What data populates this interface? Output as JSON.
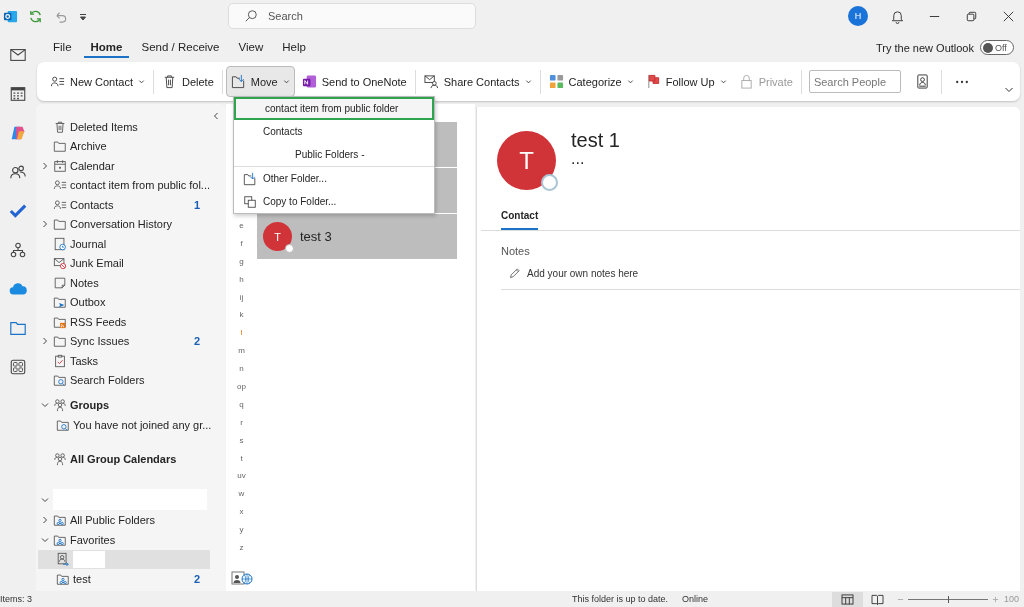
{
  "title_bar": {
    "search_placeholder": "Search",
    "avatar_initial": "H"
  },
  "menu_tabs": [
    {
      "label": "File",
      "selected": false
    },
    {
      "label": "Home",
      "selected": true
    },
    {
      "label": "Send / Receive",
      "selected": false
    },
    {
      "label": "View",
      "selected": false
    },
    {
      "label": "Help",
      "selected": false
    }
  ],
  "new_outlook": {
    "label": "Try the new Outlook",
    "toggle_text": "Off",
    "on": false
  },
  "ribbon": [
    {
      "kind": "button",
      "label": "New Contact",
      "dropdown": true,
      "pressed": false,
      "disabled": false
    },
    {
      "kind": "separator"
    },
    {
      "kind": "button",
      "label": "Delete",
      "pressed": false,
      "disabled": false
    },
    {
      "kind": "separator"
    },
    {
      "kind": "button",
      "label": "Move",
      "dropdown": true,
      "pressed": true,
      "disabled": false
    },
    {
      "kind": "button",
      "label": "Send to OneNote",
      "pressed": false,
      "disabled": false
    },
    {
      "kind": "separator"
    },
    {
      "kind": "button",
      "label": "Share Contacts",
      "dropdown": true,
      "pressed": false,
      "disabled": false
    },
    {
      "kind": "separator"
    },
    {
      "kind": "button",
      "label": "Categorize",
      "dropdown": true,
      "pressed": false,
      "disabled": false
    },
    {
      "kind": "button",
      "label": "Follow Up",
      "dropdown": true,
      "pressed": false,
      "disabled": false
    },
    {
      "kind": "button",
      "label": "Private",
      "pressed": false,
      "disabled": true
    },
    {
      "kind": "separator"
    },
    {
      "kind": "search",
      "placeholder": "Search People"
    },
    {
      "kind": "address_book"
    },
    {
      "kind": "separator"
    },
    {
      "kind": "more"
    }
  ],
  "folders": [
    {
      "label": "Deleted Items",
      "selected": false
    },
    {
      "label": "Archive",
      "selected": false
    },
    {
      "label": "Calendar",
      "expanded": false,
      "selected": false
    },
    {
      "label": "contact item from public fol...",
      "selected": false
    },
    {
      "label": "Contacts",
      "count": "1",
      "selected": false
    },
    {
      "label": "Conversation History",
      "expanded": false,
      "selected": false
    },
    {
      "label": "Journal",
      "selected": false
    },
    {
      "label": "Junk Email",
      "selected": false
    },
    {
      "label": "Notes",
      "selected": false
    },
    {
      "label": "Outbox",
      "selected": false
    },
    {
      "label": "RSS Feeds",
      "selected": false
    },
    {
      "label": "Sync Issues",
      "count": "2",
      "expanded": false,
      "selected": false
    },
    {
      "label": "Tasks",
      "selected": false
    },
    {
      "label": "Search Folders",
      "selected": false
    }
  ],
  "groups": {
    "label": "Groups",
    "expanded": true,
    "children": [
      {
        "label": "You have not joined any gr..."
      }
    ]
  },
  "group_calendars": {
    "label": "All Group Calendars"
  },
  "public_section": {
    "expanded": true,
    "items": [
      {
        "label": "All Public Folders",
        "expanded": false,
        "selected": false
      },
      {
        "label": "Favorites",
        "expanded": true,
        "selected": false,
        "children": [
          {
            "redacted": true,
            "selected": true
          },
          {
            "label": "test",
            "count": "2",
            "selected": false
          }
        ]
      }
    ]
  },
  "alphabet": [
    {
      "label": "e",
      "highlighted": false
    },
    {
      "label": "f",
      "highlighted": false
    },
    {
      "label": "g",
      "highlighted": false
    },
    {
      "label": "h",
      "highlighted": false
    },
    {
      "label": "ij",
      "highlighted": false
    },
    {
      "label": "k",
      "highlighted": false
    },
    {
      "label": "l",
      "highlighted": true
    },
    {
      "label": "m",
      "highlighted": false
    },
    {
      "label": "n",
      "highlighted": false
    },
    {
      "label": "op",
      "highlighted": false
    },
    {
      "label": "q",
      "highlighted": false
    },
    {
      "label": "r",
      "highlighted": false
    },
    {
      "label": "s",
      "highlighted": false
    },
    {
      "label": "t",
      "highlighted": false
    },
    {
      "label": "uv",
      "highlighted": false
    },
    {
      "label": "w",
      "highlighted": false
    },
    {
      "label": "x",
      "highlighted": false
    },
    {
      "label": "y",
      "highlighted": false
    },
    {
      "label": "z",
      "highlighted": false
    }
  ],
  "contacts": [
    {
      "kind": "covered",
      "selected": true
    },
    {
      "kind": "covered",
      "selected": true
    },
    {
      "kind": "contact",
      "name": "test 3",
      "initial": "T",
      "selected": true
    }
  ],
  "move_menu": [
    {
      "kind": "recent",
      "label": "contact item from public folder",
      "selected": true
    },
    {
      "kind": "recent",
      "label": "Contacts",
      "selected": false
    },
    {
      "kind": "sub",
      "label": "Public Folders -",
      "selected": false
    },
    {
      "kind": "action",
      "label": "Other Folder...",
      "selected": false
    },
    {
      "kind": "action",
      "label": "Copy to Folder...",
      "selected": false
    }
  ],
  "contact_card": {
    "initial": "T",
    "name": "test 1",
    "subtitle": "...",
    "tabs": [
      {
        "label": "Contact",
        "selected": true
      }
    ],
    "notes_heading": "Notes",
    "notes_placeholder": "Add your own notes here"
  },
  "status_bar": {
    "items": "Items: 3",
    "sync": "This folder is up to date.",
    "connection": "Online",
    "zoom": "100",
    "level": 0.5
  }
}
